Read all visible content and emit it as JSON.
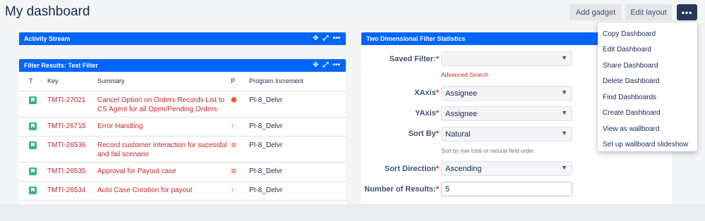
{
  "page": {
    "title": "My dashboard"
  },
  "toolbar": {
    "add_gadget": "Add gadget",
    "edit_layout": "Edit layout",
    "more": "•••"
  },
  "activity_gadget": {
    "title": "Activity Stream"
  },
  "filter_gadget": {
    "title": "Filter Results: Test Filter",
    "columns": {
      "t": "T",
      "key": "Key",
      "summary": "Summary",
      "p": "P",
      "pi": "Program Increment"
    },
    "rows": [
      {
        "key": "TMTI-27021",
        "summary": "Cancel Option on Orders Records List to CS Agent for all Open/Pending Orders",
        "priority": "highest",
        "pi": "PI-8_Delvr"
      },
      {
        "key": "TMTI-26715",
        "summary": "Error Handling",
        "priority": "high",
        "pi": "PI-8_Delvr"
      },
      {
        "key": "TMTI-26536",
        "summary": "Record customer interaction for sucessful and fail scenario",
        "priority": "highest-chevrons",
        "pi": "PI-8_Delvr"
      },
      {
        "key": "TMTI-26535",
        "summary": "Approval for Payout case",
        "priority": "highest-chevrons",
        "pi": "PI-8_Delvr"
      },
      {
        "key": "TMTI-26534",
        "summary": "Auto Case Creation for payout",
        "priority": "high",
        "pi": "PI-8_Delvr"
      }
    ]
  },
  "twod_gadget": {
    "title": "Two Dimensional Filter Statistics",
    "saved_filter": {
      "label": "Saved Filter:",
      "value": ""
    },
    "advanced_search": "Advanced Search",
    "xaxis": {
      "label": "XAxis",
      "value": "Assignee"
    },
    "yaxis": {
      "label": "YAxis",
      "value": "Assignee"
    },
    "sort_by": {
      "label": "Sort By",
      "value": "Natural",
      "hint": "Sort by row total or natural field order."
    },
    "sort_direction": {
      "label": "Sort Direction",
      "value": "Ascending"
    },
    "num_results": {
      "label": "Number of Results:",
      "value": "5"
    },
    "required_mark": "*"
  },
  "menu": {
    "items": [
      "Copy Dashboard",
      "Edit Dashboard",
      "Share Dashboard",
      "Delete Dashboard",
      "Find Dashboards",
      "Create Dashboard",
      "View as wallboard",
      "Set up wallboard slideshow"
    ]
  },
  "colors": {
    "header_blue": "#0065ff",
    "link_red": "#c1272d",
    "more_button": "#253858",
    "story_green": "#36b37e"
  }
}
